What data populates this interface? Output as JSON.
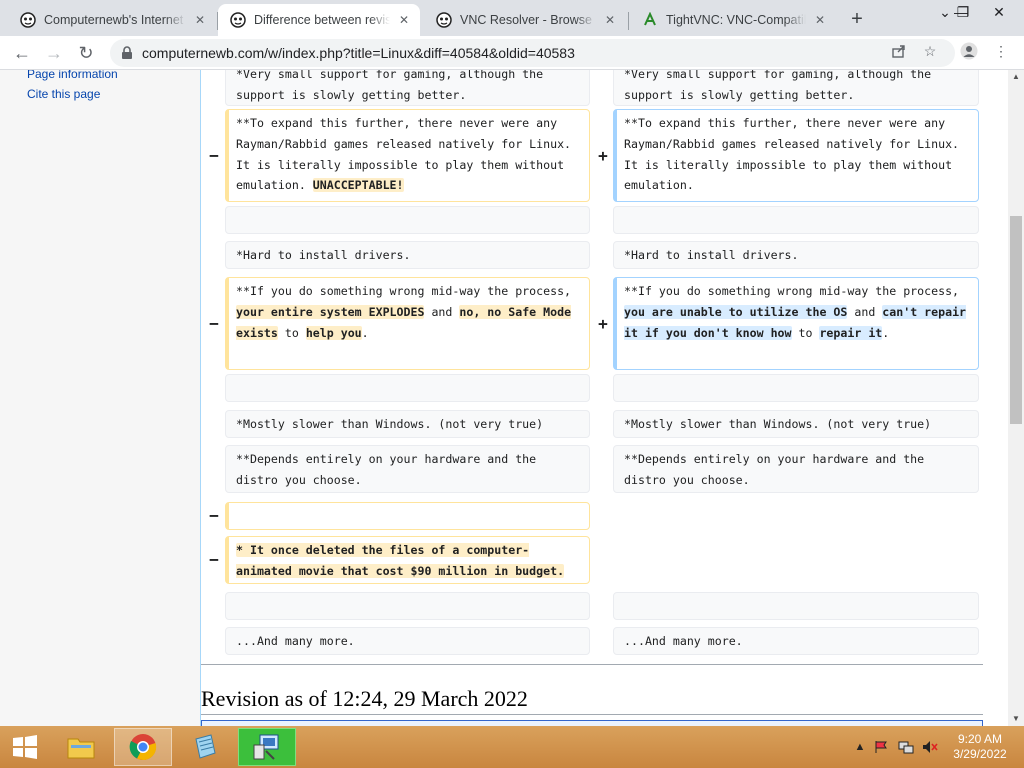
{
  "browser": {
    "tabs": [
      {
        "title": "Computernewb's Internet Pi",
        "favicon": "wiki-icon",
        "active": false
      },
      {
        "title": "Difference between revisio",
        "favicon": "wiki-icon",
        "active": true
      },
      {
        "title": "VNC Resolver - Browse",
        "favicon": "wiki-icon",
        "active": false
      },
      {
        "title": "TightVNC: VNC-Compatible",
        "favicon": "tightvnc-icon",
        "active": false
      }
    ],
    "new_tab_label": "+",
    "url": "computernewb.com/w/index.php?title=Linux&diff=40584&oldid=40583"
  },
  "sidebar": {
    "links": [
      "Page information",
      "Cite this page"
    ]
  },
  "diff": {
    "rows": [
      {
        "left": {
          "type": "context",
          "text": "*Very small support for gaming, although the support is slowly getting better."
        },
        "right": {
          "type": "context",
          "text": "*Very small support for gaming, although the support is slowly getting better."
        }
      },
      {
        "left": {
          "type": "del",
          "marker": "−",
          "segments": [
            {
              "t": "**To expand this further, there never were any Rayman/Rabbid games released natively for Linux. It is literally impossible to play them without emulation. "
            },
            {
              "t": "UNACCEPTABLE!",
              "hl": true
            }
          ]
        },
        "right": {
          "type": "add",
          "marker": "+",
          "segments": [
            {
              "t": "**To expand this further, there never were any Rayman/Rabbid games released natively for Linux. It is literally impossible to play them without emulation."
            }
          ]
        }
      },
      {
        "left": {
          "type": "context",
          "text": ""
        },
        "right": {
          "type": "context",
          "text": ""
        }
      },
      {
        "left": {
          "type": "context",
          "text": "*Hard to install drivers."
        },
        "right": {
          "type": "context",
          "text": "*Hard to install drivers."
        }
      },
      {
        "left": {
          "type": "del",
          "marker": "−",
          "segments": [
            {
              "t": "**If you do something wrong mid-way the process, "
            },
            {
              "t": "your entire system EXPLODES",
              "hl": true
            },
            {
              "t": " and "
            },
            {
              "t": "no, no Safe Mode exists",
              "hl": true
            },
            {
              "t": " to "
            },
            {
              "t": "help you",
              "hl": true
            },
            {
              "t": "."
            }
          ]
        },
        "right": {
          "type": "add",
          "marker": "+",
          "segments": [
            {
              "t": "**If you do something wrong mid-way the process, "
            },
            {
              "t": "you are unable to utilize the OS",
              "hl": true
            },
            {
              "t": " and "
            },
            {
              "t": "can't repair it if you don't know how",
              "hl": true
            },
            {
              "t": " to "
            },
            {
              "t": "repair it",
              "hl": true
            },
            {
              "t": "."
            }
          ]
        }
      },
      {
        "left": {
          "type": "context",
          "text": ""
        },
        "right": {
          "type": "context",
          "text": ""
        }
      },
      {
        "left": {
          "type": "context",
          "text": "*Mostly slower than Windows. (not very true)"
        },
        "right": {
          "type": "context",
          "text": "*Mostly slower than Windows. (not very true)"
        }
      },
      {
        "left": {
          "type": "context",
          "text": "**Depends entirely on your hardware and the distro you choose."
        },
        "right": {
          "type": "context",
          "text": "**Depends entirely on your hardware and the distro you choose."
        }
      },
      {
        "left": {
          "type": "del",
          "marker": "−",
          "segments": [
            {
              "t": ""
            }
          ]
        },
        "right": null
      },
      {
        "left": {
          "type": "del",
          "marker": "−",
          "segments": [
            {
              "t": "* It once deleted the files of a computer-animated movie that cost $90 million in budget.",
              "hl": true
            }
          ]
        },
        "right": null
      },
      {
        "left": {
          "type": "context",
          "text": ""
        },
        "right": {
          "type": "context",
          "text": ""
        }
      },
      {
        "left": {
          "type": "context",
          "text": "...And many more."
        },
        "right": {
          "type": "context",
          "text": "...And many more."
        }
      }
    ]
  },
  "revision_heading": "Revision as of 12:24, 29 March 2022",
  "taskbar": {
    "time": "9:20 AM",
    "date": "3/29/2022"
  },
  "colors": {
    "deleted_border": "#ffe49c",
    "deleted_highlight": "#feeec8",
    "added_border": "#a3d3ff",
    "added_highlight": "#d8ecff",
    "link": "#0645ad",
    "taskbar": "#c9863f"
  }
}
